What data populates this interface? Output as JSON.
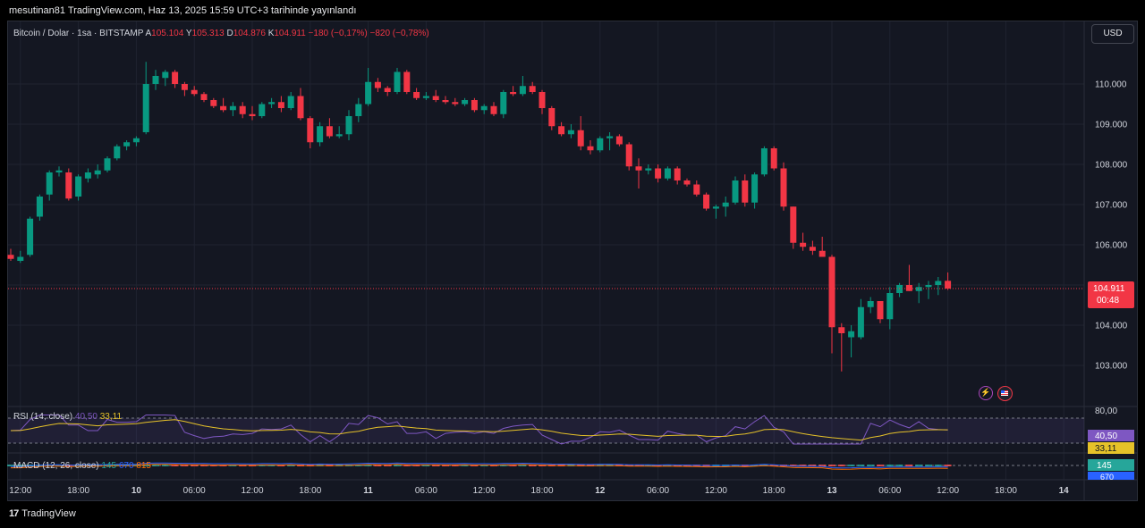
{
  "header": {
    "published": "mesutinan81 TradingView.com, Haz 13, 2025 15:59 UTC+3 tarihinde yayınlandı"
  },
  "legend": {
    "symbol": "Bitcoin / Dolar · 1sa · BITSTAMP",
    "open_label": "A",
    "open": "105.104",
    "high_label": "Y",
    "high": "105.313",
    "low_label": "D",
    "low": "104.876",
    "close_label": "K",
    "close": "104.911",
    "change": "−180 (−0,17%)",
    "change2": "−820 (−0,78%)"
  },
  "currency": "USD",
  "price_tag": {
    "price": "104.911",
    "countdown": "00:48",
    "color": "#f23645"
  },
  "rsi": {
    "label": "RSI (14, close)",
    "v1": "40,50",
    "v2": "33,11",
    "axis_top": "80,00",
    "tag1": "40,50",
    "tag2": "33,11"
  },
  "macd": {
    "label": "MACD (12, 26, close)",
    "v1": "145",
    "v2": "670",
    "v3": "815",
    "tag1": "145",
    "tag2": "670"
  },
  "footer": {
    "brand": "TradingView",
    "logo": "17"
  },
  "colors": {
    "up": "#089981",
    "down": "#f23645",
    "bg": "#141722",
    "grid": "#1f2330"
  },
  "chart_data": {
    "type": "candlestick",
    "ylim": [
      102500,
      110800
    ],
    "y_ticks": [
      "110.000",
      "109.000",
      "108.000",
      "107.000",
      "106.000",
      "105.000",
      "104.000",
      "103.000"
    ],
    "x_ticks": [
      {
        "label": "12:00",
        "bar": 1
      },
      {
        "label": "18:00",
        "bar": 7
      },
      {
        "label": "10",
        "bar": 13
      },
      {
        "label": "06:00",
        "bar": 19
      },
      {
        "label": "12:00",
        "bar": 25
      },
      {
        "label": "18:00",
        "bar": 31
      },
      {
        "label": "11",
        "bar": 37
      },
      {
        "label": "06:00",
        "bar": 43
      },
      {
        "label": "12:00",
        "bar": 49
      },
      {
        "label": "18:00",
        "bar": 55
      },
      {
        "label": "12",
        "bar": 61
      },
      {
        "label": "06:00",
        "bar": 67
      },
      {
        "label": "12:00",
        "bar": 73
      },
      {
        "label": "18:00",
        "bar": 79
      },
      {
        "label": "13",
        "bar": 85
      },
      {
        "label": "06:00",
        "bar": 91
      },
      {
        "label": "12:00",
        "bar": 97
      },
      {
        "label": "18:00",
        "bar": 103
      },
      {
        "label": "14",
        "bar": 109
      }
    ],
    "last_price": 104911,
    "candles": [
      [
        105750,
        105900,
        105600,
        105650
      ],
      [
        105600,
        105850,
        105550,
        105700
      ],
      [
        105750,
        106700,
        105700,
        106650
      ],
      [
        106700,
        107250,
        106600,
        107200
      ],
      [
        107250,
        107850,
        107100,
        107800
      ],
      [
        107800,
        107950,
        107700,
        107850
      ],
      [
        107800,
        107900,
        107100,
        107150
      ],
      [
        107200,
        107750,
        107100,
        107700
      ],
      [
        107650,
        107900,
        107550,
        107800
      ],
      [
        107750,
        108000,
        107650,
        107850
      ],
      [
        107850,
        108200,
        107800,
        108150
      ],
      [
        108150,
        108500,
        108100,
        108450
      ],
      [
        108450,
        108600,
        108350,
        108550
      ],
      [
        108550,
        108700,
        108450,
        108650
      ],
      [
        108800,
        110550,
        108750,
        110000
      ],
      [
        110000,
        110350,
        109850,
        110200
      ],
      [
        110150,
        110350,
        109950,
        110300
      ],
      [
        110300,
        110350,
        109900,
        110000
      ],
      [
        110000,
        110050,
        109700,
        109850
      ],
      [
        109850,
        109950,
        109700,
        109750
      ],
      [
        109750,
        109800,
        109550,
        109600
      ],
      [
        109600,
        109650,
        109400,
        109450
      ],
      [
        109450,
        109650,
        109300,
        109350
      ],
      [
        109350,
        109550,
        109200,
        109450
      ],
      [
        109450,
        109550,
        109150,
        109250
      ],
      [
        109250,
        109450,
        109100,
        109200
      ],
      [
        109200,
        109550,
        109150,
        109500
      ],
      [
        109500,
        109650,
        109400,
        109550
      ],
      [
        109550,
        109700,
        109300,
        109400
      ],
      [
        109400,
        109800,
        109350,
        109700
      ],
      [
        109700,
        109900,
        109100,
        109150
      ],
      [
        109150,
        109200,
        108400,
        108550
      ],
      [
        108550,
        109050,
        108450,
        108950
      ],
      [
        108950,
        109150,
        108650,
        108700
      ],
      [
        108700,
        108950,
        108650,
        108750
      ],
      [
        108750,
        109350,
        108600,
        109200
      ],
      [
        109200,
        109650,
        109050,
        109500
      ],
      [
        109500,
        110400,
        109450,
        110050
      ],
      [
        110050,
        110150,
        109800,
        109900
      ],
      [
        109900,
        109950,
        109700,
        109800
      ],
      [
        109800,
        110400,
        109750,
        110300
      ],
      [
        110300,
        110350,
        109750,
        109800
      ],
      [
        109800,
        109900,
        109600,
        109650
      ],
      [
        109650,
        109800,
        109600,
        109700
      ],
      [
        109700,
        109850,
        109550,
        109600
      ],
      [
        109600,
        109700,
        109500,
        109550
      ],
      [
        109550,
        109650,
        109450,
        109500
      ],
      [
        109500,
        109650,
        109450,
        109600
      ],
      [
        109600,
        109650,
        109300,
        109350
      ],
      [
        109350,
        109500,
        109250,
        109450
      ],
      [
        109450,
        109550,
        109200,
        109250
      ],
      [
        109250,
        109850,
        109150,
        109800
      ],
      [
        109800,
        109950,
        109700,
        109750
      ],
      [
        109750,
        110200,
        109700,
        109950
      ],
      [
        109950,
        110050,
        109750,
        109800
      ],
      [
        109800,
        109850,
        109250,
        109400
      ],
      [
        109400,
        109450,
        108850,
        108950
      ],
      [
        108950,
        109050,
        108700,
        108750
      ],
      [
        108750,
        109000,
        108650,
        108850
      ],
      [
        108850,
        109200,
        108350,
        108450
      ],
      [
        108450,
        108600,
        108250,
        108350
      ],
      [
        108350,
        108700,
        108300,
        108650
      ],
      [
        108650,
        108800,
        108350,
        108700
      ],
      [
        108700,
        108750,
        108450,
        108500
      ],
      [
        108500,
        108550,
        107850,
        107950
      ],
      [
        107950,
        108150,
        107400,
        107850
      ],
      [
        107850,
        108000,
        107750,
        107900
      ],
      [
        107900,
        108000,
        107550,
        107650
      ],
      [
        107650,
        107950,
        107600,
        107900
      ],
      [
        107900,
        107950,
        107500,
        107600
      ],
      [
        107600,
        107650,
        107450,
        107500
      ],
      [
        107500,
        107600,
        107200,
        107250
      ],
      [
        107250,
        107300,
        106850,
        106900
      ],
      [
        106900,
        107000,
        106650,
        106950
      ],
      [
        106950,
        107200,
        106700,
        107050
      ],
      [
        107050,
        107700,
        107000,
        107600
      ],
      [
        107600,
        107750,
        106950,
        107050
      ],
      [
        107050,
        107800,
        106900,
        107750
      ],
      [
        107750,
        108450,
        107700,
        108400
      ],
      [
        108400,
        108450,
        107850,
        107900
      ],
      [
        107900,
        108050,
        106850,
        106950
      ],
      [
        106950,
        106950,
        105900,
        106050
      ],
      [
        106050,
        106300,
        105850,
        105950
      ],
      [
        105950,
        106100,
        105750,
        105850
      ],
      [
        105850,
        106200,
        105700,
        105700
      ],
      [
        105700,
        105750,
        103300,
        103950
      ],
      [
        103950,
        104050,
        102850,
        103800
      ],
      [
        103700,
        104000,
        103200,
        103850
      ],
      [
        103700,
        104650,
        103650,
        104450
      ],
      [
        104450,
        104700,
        104300,
        104600
      ],
      [
        104600,
        104600,
        104050,
        104150
      ],
      [
        104150,
        104950,
        103900,
        104800
      ],
      [
        104800,
        105050,
        104700,
        105000
      ],
      [
        105000,
        105500,
        104850,
        104850
      ],
      [
        104850,
        105050,
        104550,
        104950
      ],
      [
        104950,
        105100,
        104650,
        105000
      ],
      [
        105000,
        105200,
        104750,
        105100
      ],
      [
        105104,
        105313,
        104876,
        104911
      ]
    ]
  }
}
